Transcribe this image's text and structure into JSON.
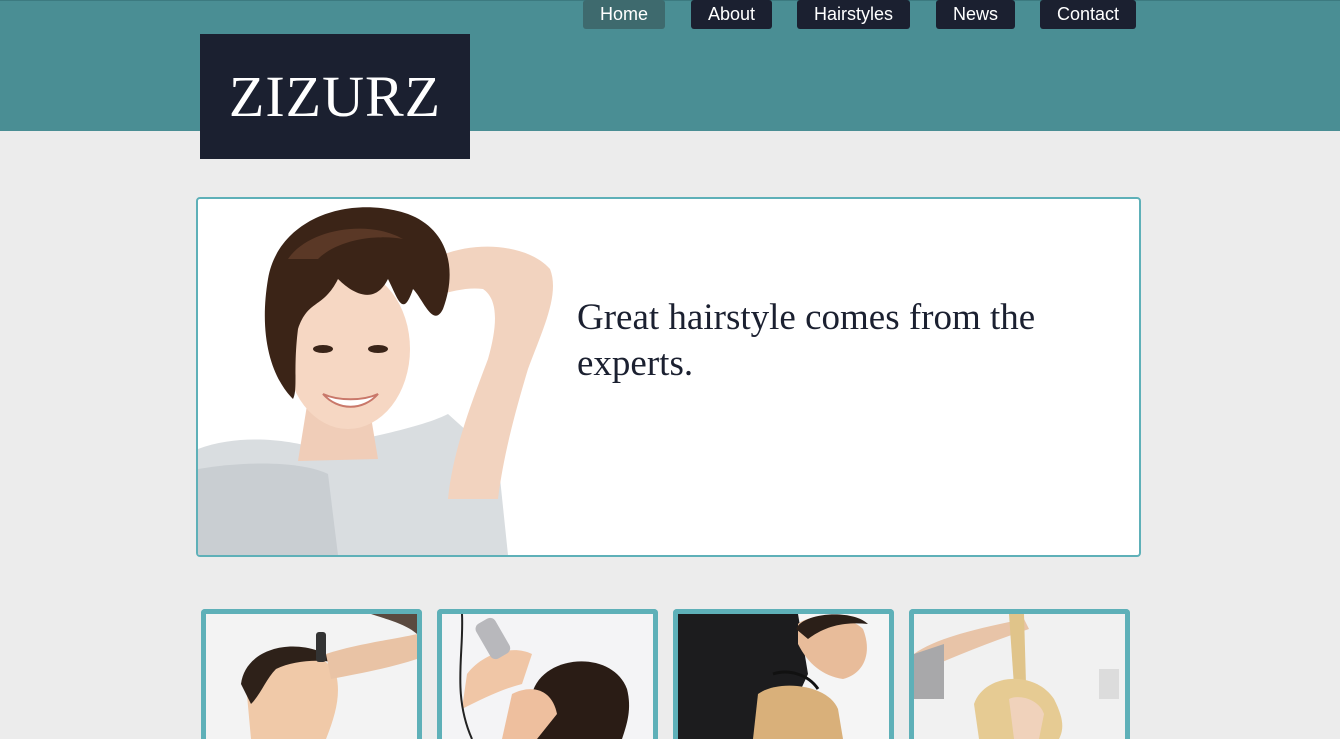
{
  "site": {
    "logo_text": "ZIZURZ"
  },
  "nav": {
    "items": [
      {
        "label": "Home",
        "active": true
      },
      {
        "label": "About",
        "active": false
      },
      {
        "label": "Hairstyles",
        "active": false
      },
      {
        "label": "News",
        "active": false
      },
      {
        "label": "Contact",
        "active": false
      }
    ]
  },
  "hero": {
    "tagline": "Great hairstyle comes from the experts."
  },
  "colors": {
    "header_bg": "#4a8e94",
    "dark": "#1b2030",
    "accent_border": "#5eb0b8",
    "page_bg": "#ececec"
  }
}
